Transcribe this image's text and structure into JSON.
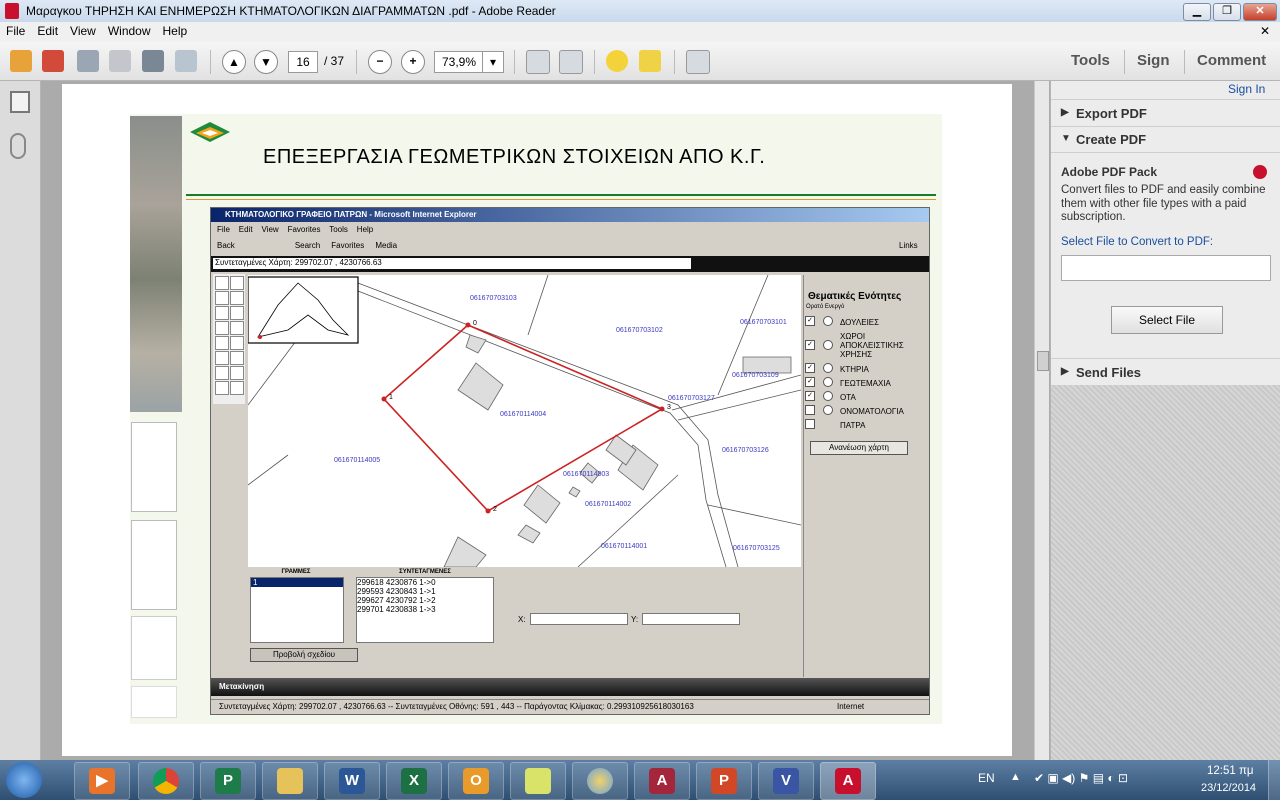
{
  "window": {
    "title": "Μαραγκου ΤΗΡΗΣΗ ΚΑΙ ΕΝΗΜΕΡΩΣΗ ΚΤΗΜΑΤΟΛΟΓΙΚΩΝ ΔΙΑΓΡΑΜΜΑΤΩΝ .pdf - Adobe Reader"
  },
  "menu": [
    "File",
    "Edit",
    "View",
    "Window",
    "Help"
  ],
  "toolbar": {
    "page_current": "16",
    "page_total": "/ 37",
    "zoom": "73,9%"
  },
  "right_tabs": {
    "tools": "Tools",
    "sign": "Sign",
    "comment": "Comment"
  },
  "panel": {
    "sign_in": "Sign In",
    "export_pdf": "Export PDF",
    "create_pdf": "Create PDF",
    "pack_title": "Adobe PDF Pack",
    "pack_desc": "Convert files to PDF and easily combine them with other file types with a paid subscription.",
    "select_label": "Select File to Convert to PDF:",
    "select_button": "Select File",
    "send_files": "Send Files"
  },
  "slide": {
    "heading": "ΕΠΕΞΕΡΓΑΣΙΑ ΓΕΩΜΕΤΡΙΚΩΝ ΣΤΟΙΧΕΙΩΝ ΑΠΟ Κ.Γ.",
    "ie": {
      "title": "ΚΤΗΜΑΤΟΛΟΓΙΚΟ ΓΡΑΦΕΙΟ ΠΑΤΡΩΝ - Microsoft Internet Explorer",
      "menu": [
        "File",
        "Edit",
        "View",
        "Favorites",
        "Tools",
        "Help"
      ],
      "toolbar": [
        "Back",
        "Search",
        "Favorites",
        "Media"
      ],
      "links": "Links",
      "coords_bar": "Συντεταγμένες Χάρτη: 299702.07 , 4230766.63",
      "layers_title": "Θεματικές Ενότητες",
      "layers_sub": "Ορατό Ενεργό",
      "layers": [
        "ΔΟΥΛΕΙΕΣ",
        "ΧΩΡΟΙ ΑΠΟΚΛΕΙΣΤΙΚΗΣ ΧΡΗΣΗΣ",
        "ΚΤΗΡΙΑ",
        "ΓΕΩΤΕΜΑΧΙΑ",
        "ΟΤΑ",
        "ΟΝΟΜΑΤΟΛΟΓΙΑ",
        "ΠΑΤΡΑ"
      ],
      "refresh": "Ανανέωση χάρτη",
      "parcels": [
        "061670703103",
        "061670703102",
        "061670703101",
        "061670703109",
        "061670114004",
        "061670114005",
        "061670703126",
        "061670114003",
        "061670114002",
        "061670114001",
        "061670703125",
        "061670703127"
      ],
      "vertex_labels": [
        "0",
        "1",
        "2",
        "3"
      ],
      "lines_header": "ΓΡΑΜΜΕΣ",
      "lines_item": "1",
      "coords_header": "ΣΥΝΤΕΤΑΓΜΕΝΕΣ",
      "coords_list": [
        "299618 4230876 1->0",
        "299593 4230843 1->1",
        "299627 4230792 1->2",
        "299701 4230838 1->3"
      ],
      "x_label": "X:",
      "y_label": "Y:",
      "show_sketch": "Προβολή σχεδίου",
      "move": "Μετακίνηση",
      "status": "Συντεταγμένες Χάρτη: 299702.07 , 4230766.63 -- Συντεταγμένες Οθόνης: 591 , 443 -- Παράγοντας Κλίμακας: 0.299310925618030163",
      "zone": "Internet"
    }
  },
  "taskbar": {
    "lang": "EN",
    "time": "12:51 πμ",
    "date": "23/12/2014",
    "apps": [
      "media-player",
      "chrome",
      "publisher",
      "explorer",
      "word",
      "excel",
      "outlook",
      "sticky-notes",
      "paint",
      "access",
      "powerpoint",
      "visio",
      "acrobat"
    ]
  },
  "colors": {
    "accent_red": "#c8102e",
    "parcel_text": "#3a3ac0",
    "polygon": "#cc2222"
  }
}
